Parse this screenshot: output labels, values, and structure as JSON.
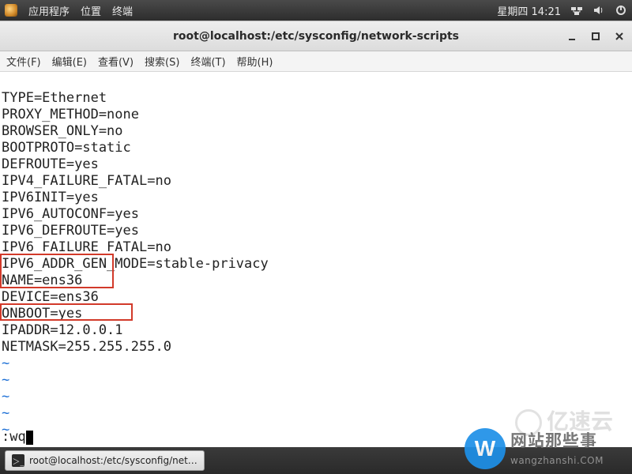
{
  "panel": {
    "menus": [
      "应用程序",
      "位置",
      "终端"
    ],
    "clock": "星期四 14:21"
  },
  "window": {
    "title": "root@localhost:/etc/sysconfig/network-scripts",
    "menubar": [
      "文件(F)",
      "编辑(E)",
      "查看(V)",
      "搜索(S)",
      "终端(T)",
      "帮助(H)"
    ]
  },
  "editor": {
    "lines": [
      "TYPE=Ethernet",
      "PROXY_METHOD=none",
      "BROWSER_ONLY=no",
      "BOOTPROTO=static",
      "DEFROUTE=yes",
      "IPV4_FAILURE_FATAL=no",
      "IPV6INIT=yes",
      "IPV6_AUTOCONF=yes",
      "IPV6_DEFROUTE=yes",
      "IPV6_FAILURE_FATAL=no",
      "IPV6_ADDR_GEN_MODE=stable-privacy",
      "NAME=ens36",
      "DEVICE=ens36",
      "ONBOOT=yes",
      "IPADDR=12.0.0.1",
      "NETMASK=255.255.255.0"
    ],
    "tilde": "~",
    "command": ":wq"
  },
  "taskbar": {
    "item": "root@localhost:/etc/sysconfig/net…"
  },
  "watermark": {
    "logo_letter": "W",
    "line1": "网站那些事",
    "line2": "wangzhanshi.COM",
    "faint": "亿速云"
  }
}
